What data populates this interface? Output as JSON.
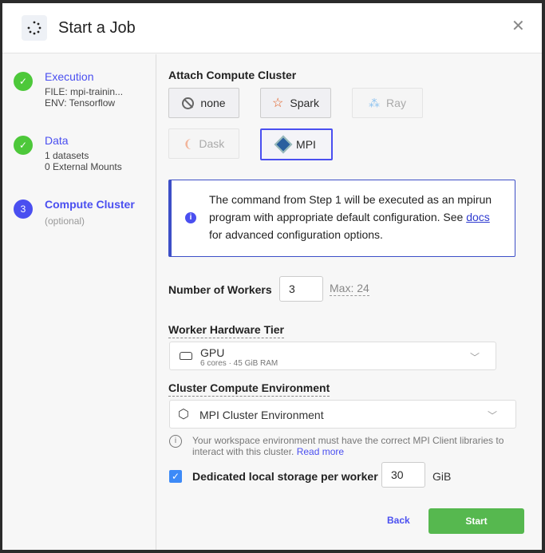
{
  "header": {
    "title": "Start a Job"
  },
  "steps": [
    {
      "label": "Execution",
      "lines": [
        "FILE: mpi-trainin...",
        "ENV: Tensorflow"
      ],
      "status": "complete"
    },
    {
      "label": "Data",
      "lines": [
        "1 datasets",
        "0 External Mounts"
      ],
      "status": "complete"
    },
    {
      "label": "Compute Cluster",
      "number": "3",
      "lines": [
        "(optional)"
      ],
      "status": "current"
    }
  ],
  "cluster": {
    "title": "Attach Compute Cluster",
    "options": [
      {
        "label": "none",
        "state": "enabled"
      },
      {
        "label": "Spark",
        "state": "enabled"
      },
      {
        "label": "Ray",
        "state": "disabled"
      },
      {
        "label": "Dask",
        "state": "disabled"
      },
      {
        "label": "MPI",
        "state": "selected"
      }
    ]
  },
  "info": {
    "text": "The command from Step 1 will be executed as an mpirun program with appropriate default configuration. See ",
    "link": "docs",
    "text2": " for advanced configuration options."
  },
  "workers": {
    "label": "Number of Workers",
    "value": "3",
    "max": "Max: 24"
  },
  "hardware": {
    "label": "Worker Hardware Tier",
    "name": "GPU",
    "detail": "6 cores · 45 GiB RAM"
  },
  "environment": {
    "label": "Cluster Compute Environment",
    "value": "MPI Cluster Environment",
    "note": "Your workspace environment must have the correct MPI Client libraries to interact with this cluster. ",
    "note_link": "Read more"
  },
  "storage": {
    "label": "Dedicated local storage per worker",
    "checked": true,
    "value": "30",
    "unit": "GiB"
  },
  "footer": {
    "back": "Back",
    "start": "Start"
  },
  "colors": {
    "accent": "#4a4ff0",
    "success": "#56b84f"
  }
}
